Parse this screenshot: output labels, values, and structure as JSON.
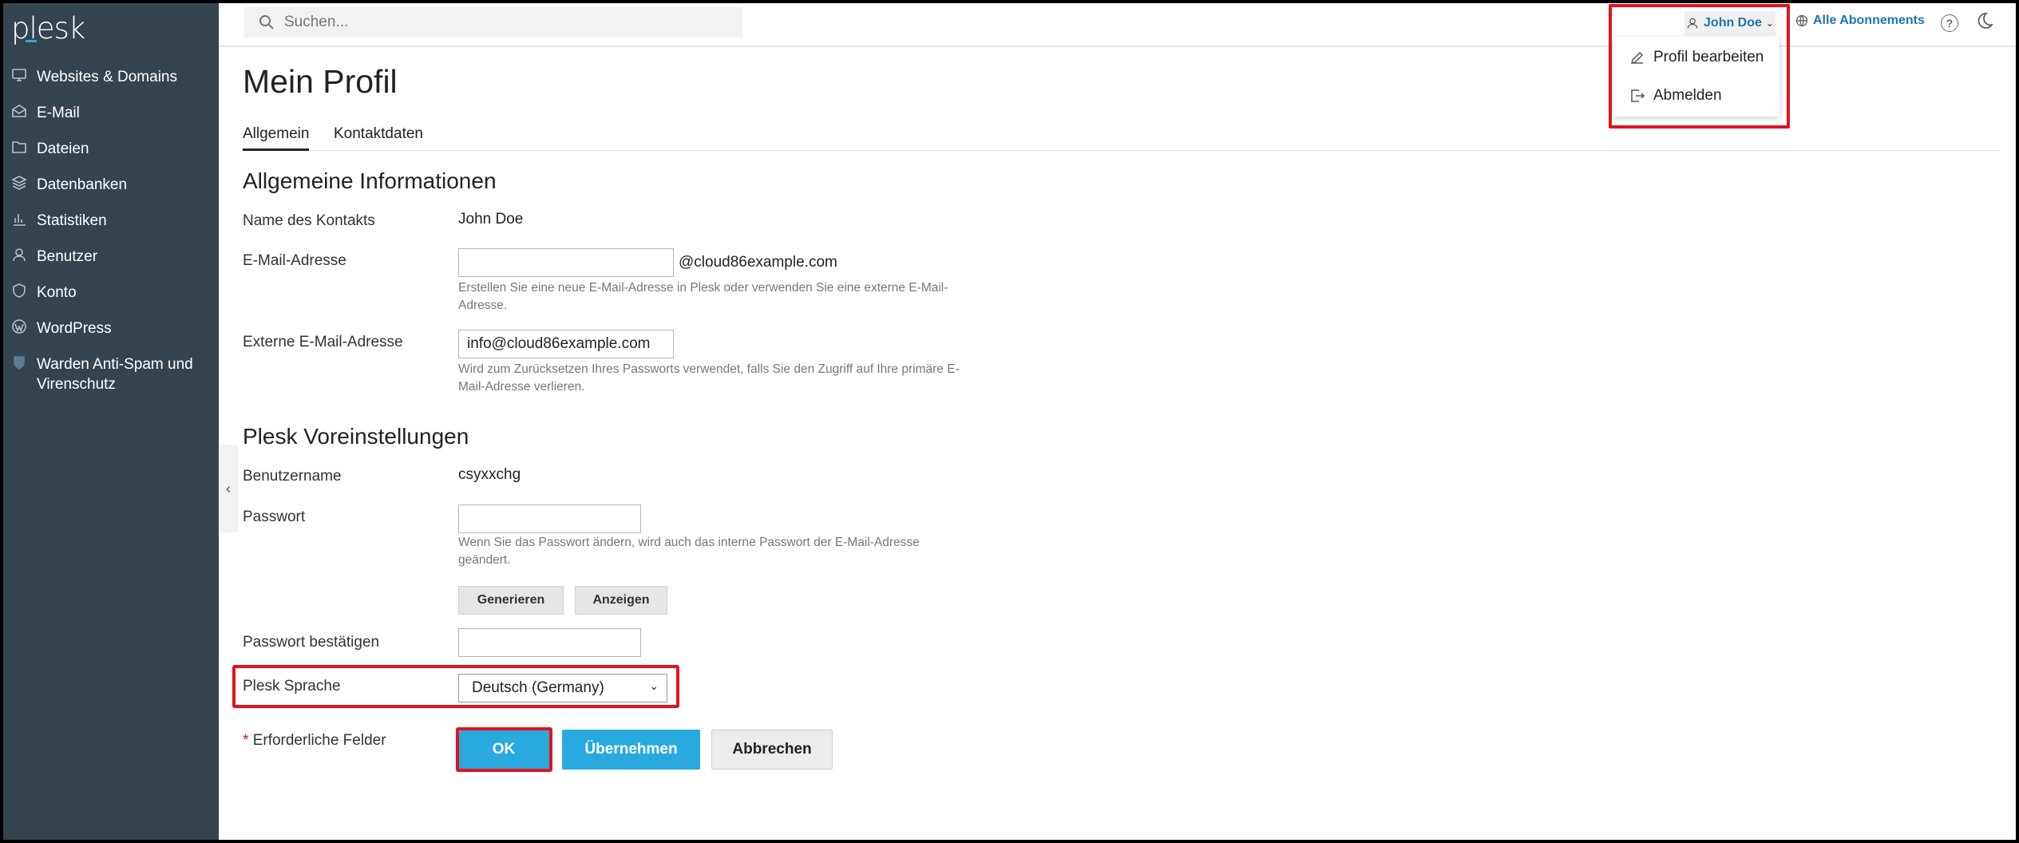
{
  "logo": "plesk",
  "sidebar": {
    "items": [
      {
        "label": "Websites & Domains",
        "icon": "monitor-icon"
      },
      {
        "label": "E-Mail",
        "icon": "mail-icon"
      },
      {
        "label": "Dateien",
        "icon": "folder-icon"
      },
      {
        "label": "Datenbanken",
        "icon": "layers-icon"
      },
      {
        "label": "Statistiken",
        "icon": "bar-chart-icon"
      },
      {
        "label": "Benutzer",
        "icon": "user-icon"
      },
      {
        "label": "Konto",
        "icon": "account-icon"
      },
      {
        "label": "WordPress",
        "icon": "wordpress-icon"
      },
      {
        "label": "Warden Anti-Spam und Virenschutz",
        "icon": "shield-icon"
      }
    ]
  },
  "topbar": {
    "search_placeholder": "Suchen...",
    "user_name": "John Doe",
    "subscriptions": "Alle Abonnements"
  },
  "dropdown": {
    "edit_profile": "Profil bearbeiten",
    "logout": "Abmelden"
  },
  "page": {
    "title": "Mein Profil",
    "tabs": [
      "Allgemein",
      "Kontaktdaten"
    ]
  },
  "general": {
    "section_title": "Allgemeine Informationen",
    "contact_name_label": "Name des Kontakts",
    "contact_name_value": "John Doe",
    "email_label": "E-Mail-Adresse",
    "email_value": "",
    "email_suffix": "@cloud86example.com",
    "email_hint": "Erstellen Sie eine neue E-Mail-Adresse in Plesk oder verwenden Sie eine externe E-Mail-Adresse.",
    "ext_email_label": "Externe E-Mail-Adresse",
    "ext_email_value": "info@cloud86example.com",
    "ext_email_hint": "Wird zum Zurücksetzen Ihres Passworts verwendet, falls Sie den Zugriff auf Ihre primäre E-Mail-Adresse verlieren."
  },
  "prefs": {
    "section_title": "Plesk Voreinstellungen",
    "username_label": "Benutzername",
    "username_value": "csyxxchg",
    "password_label": "Passwort",
    "password_hint": "Wenn Sie das Passwort ändern, wird auch das interne Passwort der E-Mail-Adresse geändert.",
    "generate_button": "Generieren",
    "show_button": "Anzeigen",
    "confirm_label": "Passwort bestätigen",
    "language_label": "Plesk Sprache",
    "language_value": "Deutsch (Germany)"
  },
  "footer": {
    "required_star": "*",
    "required_label": "Erforderliche Felder",
    "ok": "OK",
    "apply": "Übernehmen",
    "cancel": "Abbrechen"
  },
  "colors": {
    "sidebar_bg": "#36444f",
    "accent_blue": "#28aade",
    "link_blue": "#1e75b1",
    "highlight_red": "#e0141e"
  }
}
